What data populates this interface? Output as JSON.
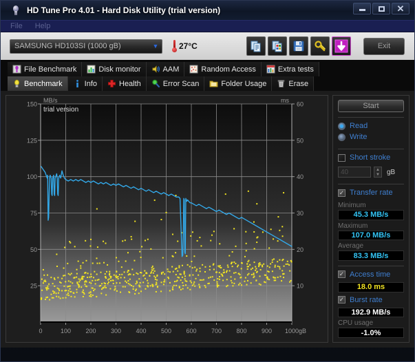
{
  "window": {
    "title": "HD Tune Pro 4.01 - Hard Disk Utility (trial version)",
    "icon": "hdtune-logo-icon",
    "buttons": {
      "minimize": "–",
      "maximize": "□",
      "close": "✕"
    }
  },
  "menu": {
    "items": [
      {
        "label": "File"
      },
      {
        "label": "Help"
      }
    ]
  },
  "toolbar": {
    "drive": "SAMSUNG HD103SI (1000 gB)",
    "dropdown_arrow": "▼",
    "temperature": "27°C",
    "icons": [
      {
        "name": "copy-text-icon"
      },
      {
        "name": "copy-image-icon"
      },
      {
        "name": "save-icon"
      },
      {
        "name": "settings-icon"
      },
      {
        "name": "download-icon"
      }
    ],
    "exit_label": "Exit"
  },
  "tabs": {
    "row1": [
      {
        "label": "File Benchmark",
        "icon": "file-benchmark-icon",
        "active": false
      },
      {
        "label": "Disk monitor",
        "icon": "disk-monitor-icon",
        "active": false
      },
      {
        "label": "AAM",
        "icon": "aam-speaker-icon",
        "active": false
      },
      {
        "label": "Random Access",
        "icon": "random-access-icon",
        "active": false
      },
      {
        "label": "Extra tests",
        "icon": "extra-tests-icon",
        "active": false
      }
    ],
    "row2": [
      {
        "label": "Benchmark",
        "icon": "benchmark-bulb-icon",
        "active": true
      },
      {
        "label": "Info",
        "icon": "info-icon",
        "active": false
      },
      {
        "label": "Health",
        "icon": "health-cross-icon",
        "active": false
      },
      {
        "label": "Error Scan",
        "icon": "error-scan-magnifier-icon",
        "active": false
      },
      {
        "label": "Folder Usage",
        "icon": "folder-usage-icon",
        "active": false
      },
      {
        "label": "Erase",
        "icon": "erase-trash-icon",
        "active": false
      }
    ]
  },
  "sidebar": {
    "start_label": "Start",
    "mode": [
      {
        "label": "Read",
        "selected": true
      },
      {
        "label": "Write",
        "selected": false
      }
    ],
    "short_stroke": {
      "label": "Short stroke",
      "checked": false,
      "value": "40",
      "unit": "gB"
    },
    "transfer_rate": {
      "label": "Transfer rate",
      "checked": true,
      "minimum_label": "Minimum",
      "minimum_value": "45.3 MB/s",
      "maximum_label": "Maximum",
      "maximum_value": "107.0 MB/s",
      "average_label": "Average",
      "average_value": "83.3 MB/s"
    },
    "access_time": {
      "label": "Access time",
      "checked": true,
      "value": "18.0 ms"
    },
    "burst_rate": {
      "label": "Burst rate",
      "checked": true,
      "value": "192.9 MB/s"
    },
    "cpu_usage": {
      "label": "CPU usage",
      "value": "-1.0%"
    }
  },
  "chart_data": {
    "type": "line",
    "title": "",
    "watermark": "trial version",
    "xlabel": "gB",
    "ylabel": "MB/s",
    "y2label": "ms",
    "xlim": [
      0,
      1000
    ],
    "ylim": [
      0,
      150
    ],
    "y2lim": [
      0,
      60
    ],
    "xticks": [
      0,
      100,
      200,
      300,
      400,
      500,
      600,
      700,
      800,
      900,
      1000
    ],
    "yticks": [
      25,
      50,
      75,
      100,
      125,
      150
    ],
    "y2ticks": [
      10,
      20,
      30,
      40,
      50,
      60
    ],
    "grid": true,
    "legend": "none",
    "series": [
      {
        "name": "Transfer rate",
        "color": "#33a8e8",
        "type": "line",
        "axis": "left",
        "unit": "MB/s",
        "x": [
          2,
          6,
          10,
          14,
          18,
          20,
          22,
          24,
          26,
          28,
          30,
          32,
          34,
          36,
          38,
          40,
          42,
          44,
          46,
          48,
          50,
          52,
          54,
          56,
          58,
          60,
          62,
          64,
          66,
          68,
          70,
          72,
          74,
          76,
          78,
          80,
          85,
          90,
          95,
          100,
          110,
          120,
          130,
          140,
          150,
          160,
          170,
          180,
          190,
          200,
          210,
          220,
          230,
          240,
          250,
          260,
          270,
          280,
          290,
          300,
          310,
          320,
          330,
          340,
          350,
          360,
          370,
          380,
          390,
          400,
          410,
          420,
          430,
          440,
          450,
          460,
          470,
          480,
          490,
          500,
          510,
          520,
          530,
          540,
          550,
          555,
          560,
          563,
          566,
          568,
          570,
          572,
          574,
          576,
          578,
          580,
          582,
          585,
          590,
          595,
          600,
          610,
          620,
          630,
          640,
          650,
          660,
          670,
          680,
          690,
          700,
          710,
          720,
          730,
          740,
          750,
          760,
          770,
          780,
          790,
          800,
          810,
          820,
          830,
          840,
          850,
          860,
          870,
          880,
          890,
          900,
          910,
          920,
          930,
          940,
          950,
          960,
          970,
          980,
          990,
          1000
        ],
        "y": [
          107,
          106,
          105,
          104,
          103,
          102,
          101,
          100,
          99,
          101,
          70,
          72,
          88,
          99,
          101,
          100,
          99,
          88,
          87,
          99,
          100,
          101,
          88,
          87,
          99,
          100,
          101,
          102,
          99,
          88,
          87,
          99,
          100,
          101,
          100,
          99,
          104,
          101,
          99,
          98,
          97,
          98,
          97,
          98,
          97,
          98,
          97,
          96,
          97,
          96,
          97,
          96,
          95,
          96,
          95,
          96,
          95,
          94,
          95,
          94,
          95,
          94,
          93,
          94,
          93,
          92,
          93,
          92,
          91,
          92,
          91,
          90,
          91,
          90,
          89,
          90,
          89,
          88,
          89,
          88,
          87,
          88,
          87,
          86,
          86,
          85,
          60,
          45,
          46,
          60,
          85,
          84,
          48,
          47,
          85,
          84,
          83,
          84,
          83,
          82,
          82,
          81,
          80,
          81,
          80,
          79,
          78,
          79,
          78,
          77,
          76,
          77,
          76,
          75,
          74,
          75,
          74,
          73,
          72,
          71,
          72,
          71,
          70,
          69,
          68,
          67,
          66,
          65,
          64,
          63,
          62,
          61,
          60,
          59,
          58,
          57,
          56,
          55,
          54,
          53,
          52
        ]
      },
      {
        "name": "Access time",
        "color": "#f2e422",
        "type": "scatter",
        "axis": "right",
        "unit": "ms",
        "description": "dense yellow scatter of per-request access times, mostly between 8 and 20 ms, with sparse outliers up to 35 ms"
      }
    ]
  }
}
